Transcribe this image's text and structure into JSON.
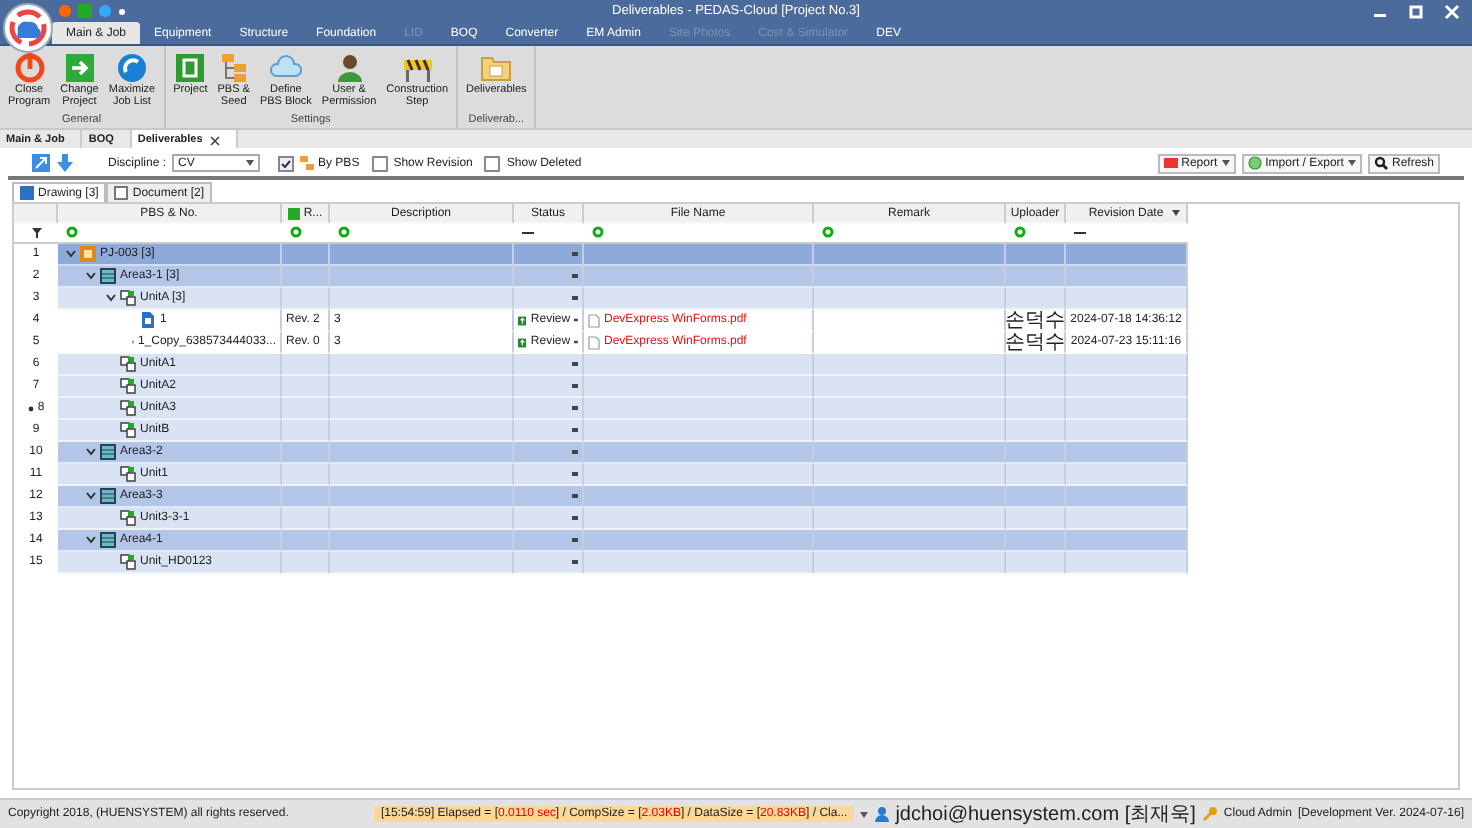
{
  "window": {
    "title": "Deliverables - PEDAS-Cloud [Project No.3]"
  },
  "menu_tabs": [
    {
      "label": "Main & Job",
      "selected": true,
      "disabled": false
    },
    {
      "label": "Equipment",
      "selected": false,
      "disabled": false
    },
    {
      "label": "Structure",
      "selected": false,
      "disabled": false
    },
    {
      "label": "Foundation",
      "selected": false,
      "disabled": false
    },
    {
      "label": "LID",
      "selected": false,
      "disabled": true
    },
    {
      "label": "BOQ",
      "selected": false,
      "disabled": false
    },
    {
      "label": "Converter",
      "selected": false,
      "disabled": false
    },
    {
      "label": "EM Admin",
      "selected": false,
      "disabled": false
    },
    {
      "label": "Site Photos",
      "selected": false,
      "disabled": true
    },
    {
      "label": "Cost & Simulator",
      "selected": false,
      "disabled": true
    },
    {
      "label": "DEV",
      "selected": false,
      "disabled": false
    }
  ],
  "ribbon_groups": [
    {
      "label": "General",
      "buttons": [
        {
          "label": "Close\nProgram",
          "kind": "power"
        },
        {
          "label": "Change\nProject",
          "kind": "change"
        },
        {
          "label": "Maximize\nJob List",
          "kind": "maximize"
        }
      ]
    },
    {
      "label": "Settings",
      "buttons": [
        {
          "label": "Project",
          "kind": "project"
        },
        {
          "label": "PBS &\nSeed",
          "kind": "tree"
        },
        {
          "label": "Define\nPBS Block",
          "kind": "block"
        },
        {
          "label": "User &\nPermission",
          "kind": "user"
        },
        {
          "label": "Construction\nStep",
          "kind": "barrier"
        }
      ]
    },
    {
      "label": "Deliverab...",
      "buttons": [
        {
          "label": "Deliverables",
          "kind": "folder"
        }
      ]
    }
  ],
  "doc_tabs": [
    {
      "label": "Main & Job",
      "selected": false,
      "closable": false
    },
    {
      "label": "BOQ",
      "selected": false,
      "closable": false
    },
    {
      "label": "Deliverables",
      "selected": true,
      "closable": true
    }
  ],
  "toolbar": {
    "discipline_label": "Discipline :",
    "discipline_value": "CV",
    "options": [
      {
        "label": "By PBS",
        "checked": true,
        "icon": true
      },
      {
        "label": "Show Revision",
        "checked": false,
        "icon": false
      },
      {
        "label": "Show Deleted",
        "checked": false,
        "icon": false
      }
    ],
    "actions": [
      {
        "label": "Report",
        "kind": "report",
        "dropdown": true
      },
      {
        "label": "Import / Export",
        "kind": "import",
        "dropdown": true
      },
      {
        "label": "Refresh",
        "kind": "refresh",
        "dropdown": false
      }
    ]
  },
  "sub_tabs": [
    {
      "label": "Drawing [3]",
      "selected": true
    },
    {
      "label": "Document [2]",
      "selected": false
    }
  ],
  "grid": {
    "columns": [
      {
        "label": "PBS & No.",
        "filter": {
          "kind": "icon"
        },
        "icon": false,
        "sort": false
      },
      {
        "label": "R...",
        "filter": {
          "kind": "icon"
        },
        "icon": true,
        "sort": false
      },
      {
        "label": "Description",
        "filter": {
          "kind": "icon"
        },
        "icon": false,
        "sort": false
      },
      {
        "label": "Status",
        "filter": {
          "kind": "dash"
        },
        "icon": false,
        "sort": false
      },
      {
        "label": "File Name",
        "filter": {
          "kind": "icon"
        },
        "icon": false,
        "sort": false
      },
      {
        "label": "Remark",
        "filter": {
          "kind": "icon"
        },
        "icon": false,
        "sort": false
      },
      {
        "label": "Uploader",
        "filter": {
          "kind": "icon"
        },
        "icon": false,
        "sort": false
      },
      {
        "label": "Revision Date",
        "filter": {
          "kind": "dash"
        },
        "icon": false,
        "sort": true
      }
    ],
    "rows": [
      {
        "num": "1",
        "kind": "project",
        "label": "PJ-003 [3]",
        "expanded": true,
        "focused": false,
        "children": [
          {
            "num": "2",
            "kind": "area",
            "label": "Area3-1 [3]",
            "expanded": true,
            "focused": false,
            "children": [
              {
                "num": "3",
                "kind": "unit",
                "label": "UnitA [3]",
                "expanded": true,
                "focused": false,
                "children": [
                  {
                    "num": "4",
                    "kind": "doc",
                    "label": "1",
                    "rev": "Rev. 2",
                    "description": "3",
                    "status": "Review",
                    "file": "DevExpress WinForms.pdf",
                    "uploader": "손덕수",
                    "date": "2024-07-18 14:36:12",
                    "focused": false
                  },
                  {
                    "num": "5",
                    "kind": "doc",
                    "label": "1_Copy_638573444033...",
                    "rev": "Rev. 0",
                    "description": "3",
                    "status": "Review",
                    "file": "DevExpress WinForms.pdf",
                    "uploader": "손덕수",
                    "date": "2024-07-23 15:11:16",
                    "focused": false
                  }
                ]
              },
              {
                "num": "6",
                "kind": "unit",
                "label": "UnitA1",
                "focused": false
              },
              {
                "num": "7",
                "kind": "unit",
                "label": "UnitA2",
                "focused": false
              },
              {
                "num": "8",
                "kind": "unit",
                "label": "UnitA3",
                "focused": true
              },
              {
                "num": "9",
                "kind": "unit",
                "label": "UnitB",
                "focused": false
              }
            ]
          },
          {
            "num": "10",
            "kind": "area",
            "label": "Area3-2",
            "expanded": true,
            "focused": false,
            "children": [
              {
                "num": "11",
                "kind": "unit",
                "label": "Unit1",
                "focused": false
              }
            ]
          },
          {
            "num": "12",
            "kind": "area",
            "label": "Area3-3",
            "expanded": true,
            "focused": false,
            "children": [
              {
                "num": "13",
                "kind": "unit",
                "label": "Unit3-3-1",
                "focused": false
              }
            ]
          },
          {
            "num": "14",
            "kind": "area",
            "label": "Area4-1",
            "expanded": true,
            "focused": false,
            "children": [
              {
                "num": "15",
                "kind": "unit",
                "label": "Unit_HD0123",
                "focused": false
              }
            ]
          }
        ]
      }
    ]
  },
  "status_bar": {
    "copyright": "Copyright 2018, (HUENSYSTEM) all rights reserved.",
    "log": [
      {
        "text": "[15:54:59] Elapsed = [",
        "highlight": false
      },
      {
        "text": "0.0110 sec",
        "highlight": true
      },
      {
        "text": "] / CompSize = [",
        "highlight": false
      },
      {
        "text": "2.03KB",
        "highlight": true
      },
      {
        "text": "] / DataSize = [",
        "highlight": false
      },
      {
        "text": "20.83KB",
        "highlight": true
      },
      {
        "text": "] / Cla...",
        "highlight": false
      }
    ],
    "user": "jdchoi@huensystem.com [최재욱]",
    "role": "Cloud Admin",
    "version": "[Development Ver. 2024-07-16]"
  }
}
